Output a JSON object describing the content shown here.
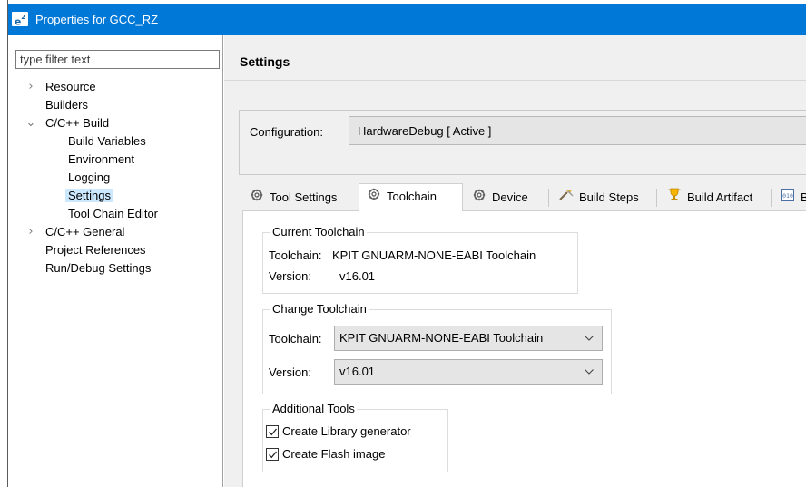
{
  "window": {
    "title": "Properties for GCC_RZ",
    "icon": "e2-app-icon"
  },
  "sidebar": {
    "filter_placeholder": "type filter text",
    "items": [
      {
        "label": "Resource",
        "arrow": ">"
      },
      {
        "label": "Builders"
      },
      {
        "label": "C/C++ Build",
        "arrow": "v"
      },
      {
        "label": "Build Variables"
      },
      {
        "label": "Environment"
      },
      {
        "label": "Logging"
      },
      {
        "label": "Settings",
        "selected": true
      },
      {
        "label": "Tool Chain Editor"
      },
      {
        "label": "C/C++ General",
        "arrow": ">"
      },
      {
        "label": "Project References"
      },
      {
        "label": "Run/Debug Settings"
      }
    ]
  },
  "main": {
    "title": "Settings",
    "configuration_label": "Configuration:",
    "configuration_value": "HardwareDebug  [ Active ]",
    "tabs": [
      {
        "label": "Tool Settings",
        "icon": "gear-icon"
      },
      {
        "label": "Toolchain",
        "icon": "gear-icon",
        "active": true
      },
      {
        "label": "Device",
        "icon": "gear-icon"
      },
      {
        "label": "Build Steps",
        "icon": "build-steps-icon"
      },
      {
        "label": "Build Artifact",
        "icon": "trophy-icon"
      },
      {
        "label": "B",
        "icon": "binary-icon"
      }
    ],
    "current_toolchain": {
      "title": "Current Toolchain",
      "toolchain_label": "Toolchain:",
      "toolchain_value": "KPIT GNUARM-NONE-EABI Toolchain",
      "version_label": "Version:",
      "version_value": "v16.01"
    },
    "change_toolchain": {
      "title": "Change Toolchain",
      "toolchain_label": "Toolchain:",
      "toolchain_selected": "KPIT GNUARM-NONE-EABI Toolchain",
      "version_label": "Version:",
      "version_selected": "v16.01"
    },
    "additional_tools": {
      "title": "Additional Tools",
      "options": [
        {
          "label": "Create Library generator",
          "checked": true
        },
        {
          "label": "Create Flash image",
          "checked": true
        }
      ]
    }
  },
  "colors": {
    "titlebar": "#0078d7",
    "selection": "#cce8ff",
    "pane_background": "#f0f0f0"
  }
}
